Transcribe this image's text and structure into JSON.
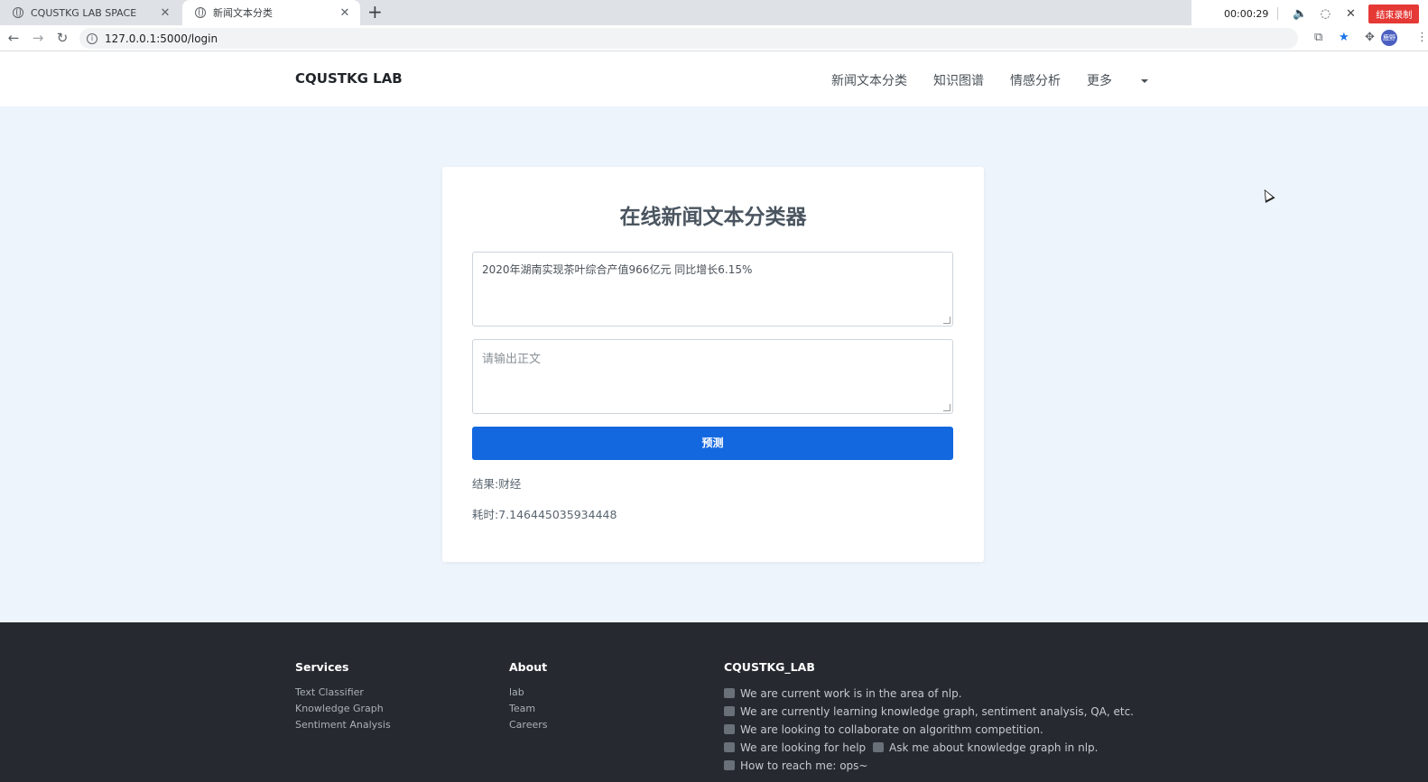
{
  "browser": {
    "tabs": [
      {
        "title": "CQUSTKG LAB SPACE"
      },
      {
        "title": "新闻文本分类"
      }
    ],
    "new_tab": "+",
    "url": "127.0.0.1:5000/login",
    "recording": {
      "timer": "00:00:29",
      "stop_label": "结束录制"
    },
    "profile_initial": "鹿野"
  },
  "navbar": {
    "brand": "CQUSTKG LAB",
    "items": [
      "新闻文本分类",
      "知识图谱",
      "情感分析",
      "更多"
    ]
  },
  "card": {
    "title": "在线新闻文本分类器",
    "title_input_value": "2020年湖南实现茶叶综合产值966亿元 同比增长6.15%",
    "body_placeholder": "请输出正文",
    "predict_label": "预测",
    "result_text": "结果:财经",
    "time_text": "耗时:7.146445035934448"
  },
  "footer": {
    "services": {
      "heading": "Services",
      "links": [
        "Text Classifier",
        "Knowledge Graph",
        "Sentiment Analysis"
      ]
    },
    "about": {
      "heading": "About",
      "links": [
        "lab",
        "Team",
        "Careers"
      ]
    },
    "lab": {
      "heading": "CQUSTKG_LAB",
      "lines": [
        "We are current work is in the area of nlp.",
        "We are currently learning knowledge graph, sentiment analysis, QA, etc.",
        "We are looking to collaborate on algorithm competition.",
        "We are looking for help",
        "Ask me about knowledge graph in nlp.",
        "How to reach me: ops~"
      ]
    }
  },
  "colors": {
    "primary": "#1368e0",
    "footer_bg": "#262a30",
    "page_bg": "#eef4fb"
  }
}
